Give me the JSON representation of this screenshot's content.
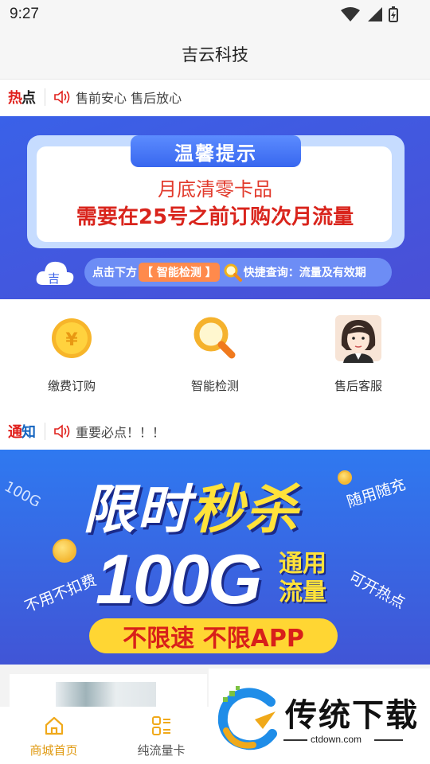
{
  "status": {
    "time": "9:27"
  },
  "header": {
    "title": "吉云科技"
  },
  "ticker1": {
    "label_a": "热",
    "label_b": "点",
    "text": "售前安心 售后放心"
  },
  "banner1": {
    "tab": "温馨提示",
    "line1": "月底清零卡品",
    "line2": "需要在25号之前订购次月流量",
    "pill_pre": "点击下方",
    "pill_tag": "【 智能检测 】",
    "pill_post": "快捷查询：流量及有效期",
    "cloud_char": "吉"
  },
  "quick": [
    {
      "label": "缴费订购",
      "icon": "coin-icon"
    },
    {
      "label": "智能检测",
      "icon": "magnifier-icon"
    },
    {
      "label": "售后客服",
      "icon": "agent-avatar-icon"
    }
  ],
  "ticker2": {
    "label_a": "通",
    "label_b": "知",
    "text": "重要必点！！！"
  },
  "banner2": {
    "title_a": "限时",
    "title_b": "秒杀",
    "big": "100G",
    "side1": "通用",
    "side2": "流量",
    "bar": "不限速 不限APP",
    "float_left": "不用不扣费",
    "float_right": "可开热点",
    "float_top": "随用随充",
    "float_corner": "100G"
  },
  "tabs": [
    {
      "label": "商城首页",
      "icon": "home-icon",
      "active": true
    },
    {
      "label": "纯流量卡",
      "icon": "list-icon",
      "active": false
    }
  ],
  "watermark": {
    "text": "传统下载",
    "url": "ctdown.com"
  },
  "colors": {
    "brand_blue": "#3a61e8",
    "accent_orange": "#f0a91a",
    "red": "#e0201c"
  }
}
